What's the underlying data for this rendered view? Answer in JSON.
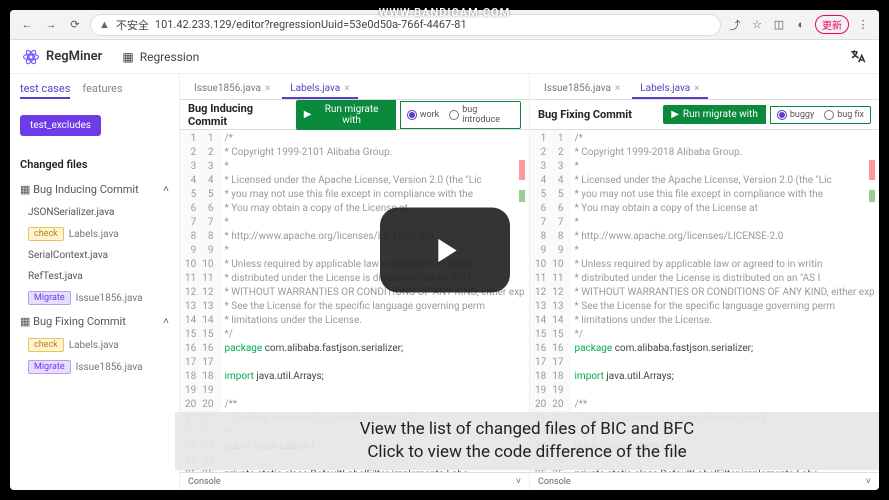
{
  "watermark": "WWW.BANDICAM.COM",
  "browser": {
    "secure": "不安全",
    "url": "101.42.233.129/editor?regressionUuid=53e0d50a-766f-4467-81",
    "ext_label": "更新"
  },
  "app": {
    "name": "RegMiner",
    "tab": "Regression"
  },
  "sidebar": {
    "tabs": {
      "a": "test cases",
      "b": "features"
    },
    "btn": "test_excludes",
    "title": "Changed files",
    "bic": {
      "head": "Bug Inducing Commit",
      "f1": "JSONSerializer.java",
      "check": "check",
      "f2": "Labels.java",
      "f3": "SerialContext.java",
      "f4": "RefTest.java",
      "mig": "Migrate",
      "f5": "Issue1856.java"
    },
    "bfc": {
      "head": "Bug Fixing Commit",
      "check": "check",
      "f1": "Labels.java",
      "mig": "Migrate",
      "f2": "Issue1856.java"
    }
  },
  "left": {
    "title": "Bug Inducing Commit",
    "run": "Run migrate with",
    "r1": "work",
    "r2": "bug introduce",
    "tab1": "Issue1856.java",
    "tab2": "Labels.java",
    "console": "Console"
  },
  "right": {
    "title": "Bug Fixing Commit",
    "run": "Run migrate with",
    "r1": "buggy",
    "r2": "bug fix",
    "tab1": "Issue1856.java",
    "tab2": "Labels.java",
    "console": "Console"
  },
  "code_left": {
    "lines": [
      [
        1,
        1,
        "/*"
      ],
      [
        2,
        2,
        " * Copyright 1999-2101 Alibaba Group."
      ],
      [
        3,
        3,
        " *"
      ],
      [
        4,
        4,
        " * Licensed under the Apache License, Version 2.0 (the \"Lic"
      ],
      [
        5,
        5,
        " * you may not use this file except in compliance with the"
      ],
      [
        6,
        6,
        " * You may obtain a copy of the License at"
      ],
      [
        7,
        7,
        " *"
      ],
      [
        8,
        8,
        " *      http://www.apache.org/licenses/LICENSE-2.0"
      ],
      [
        9,
        9,
        " *"
      ],
      [
        10,
        10,
        " * Unless required by applicable law or agreed to in writin"
      ],
      [
        11,
        11,
        " * distributed under the License is distributed on an \"AS I"
      ],
      [
        12,
        12,
        " * WITHOUT WARRANTIES OR CONDITIONS OF ANY KIND, either exp"
      ],
      [
        13,
        13,
        " * See the License for the specific language governing perm"
      ],
      [
        14,
        14,
        " * limitations under the License."
      ],
      [
        15,
        15,
        " */"
      ],
      [
        16,
        16,
        "package com.alibaba.fastjson.serializer;"
      ],
      [
        17,
        17,
        ""
      ],
      [
        18,
        18,
        "import java.util.Arrays;"
      ],
      [
        19,
        19,
        ""
      ],
      [
        20,
        20,
        "/**"
      ],
      [
        21,
        21,
        " * @author wenshao[szujobs@hotmail.com]"
      ],
      [
        22,
        22,
        " */"
      ],
      [
        23,
        23,
        "public class Labels {"
      ],
      [
        24,
        24,
        ""
      ],
      [
        25,
        25,
        "    private static class DefaultLabelFilter implements Labe"
      ]
    ]
  },
  "code_right": {
    "lines": [
      [
        1,
        1,
        "/*"
      ],
      [
        2,
        2,
        " * Copyright 1999-2018 Alibaba Group."
      ],
      [
        3,
        3,
        " *"
      ],
      [
        4,
        4,
        " * Licensed under the Apache License, Version 2.0 (the \"Lic"
      ],
      [
        5,
        5,
        " * you may not use this file except in compliance with the"
      ],
      [
        6,
        6,
        " * You may obtain a copy of the License at"
      ],
      [
        7,
        7,
        " *"
      ],
      [
        8,
        8,
        " *      http://www.apache.org/licenses/LICENSE-2.0"
      ],
      [
        9,
        9,
        " *"
      ],
      [
        10,
        10,
        " * Unless required by applicable law or agreed to in writin"
      ],
      [
        11,
        11,
        " * distributed under the License is distributed on an \"AS I"
      ],
      [
        12,
        12,
        " * WITHOUT WARRANTIES OR CONDITIONS OF ANY KIND, either exp"
      ],
      [
        13,
        13,
        " * See the License for the specific language governing perm"
      ],
      [
        14,
        14,
        " * limitations under the License."
      ],
      [
        15,
        15,
        " */"
      ],
      [
        16,
        16,
        "package com.alibaba.fastjson.serializer;"
      ],
      [
        17,
        17,
        ""
      ],
      [
        18,
        18,
        "import java.util.Arrays;"
      ],
      [
        19,
        19,
        ""
      ],
      [
        20,
        20,
        "/**"
      ],
      [
        21,
        21,
        " * @author wenshao[szujobs@hotmail.com]"
      ],
      [
        22,
        22,
        " */"
      ],
      [
        23,
        23,
        "public class Labels {"
      ],
      [
        24,
        24,
        ""
      ],
      [
        25,
        25,
        "    private static class DefaultLabelFilter implements Labe"
      ]
    ]
  },
  "caption": {
    "l1": "View the list of changed files of BIC and BFC",
    "l2": "Click to view the code difference of the file"
  }
}
